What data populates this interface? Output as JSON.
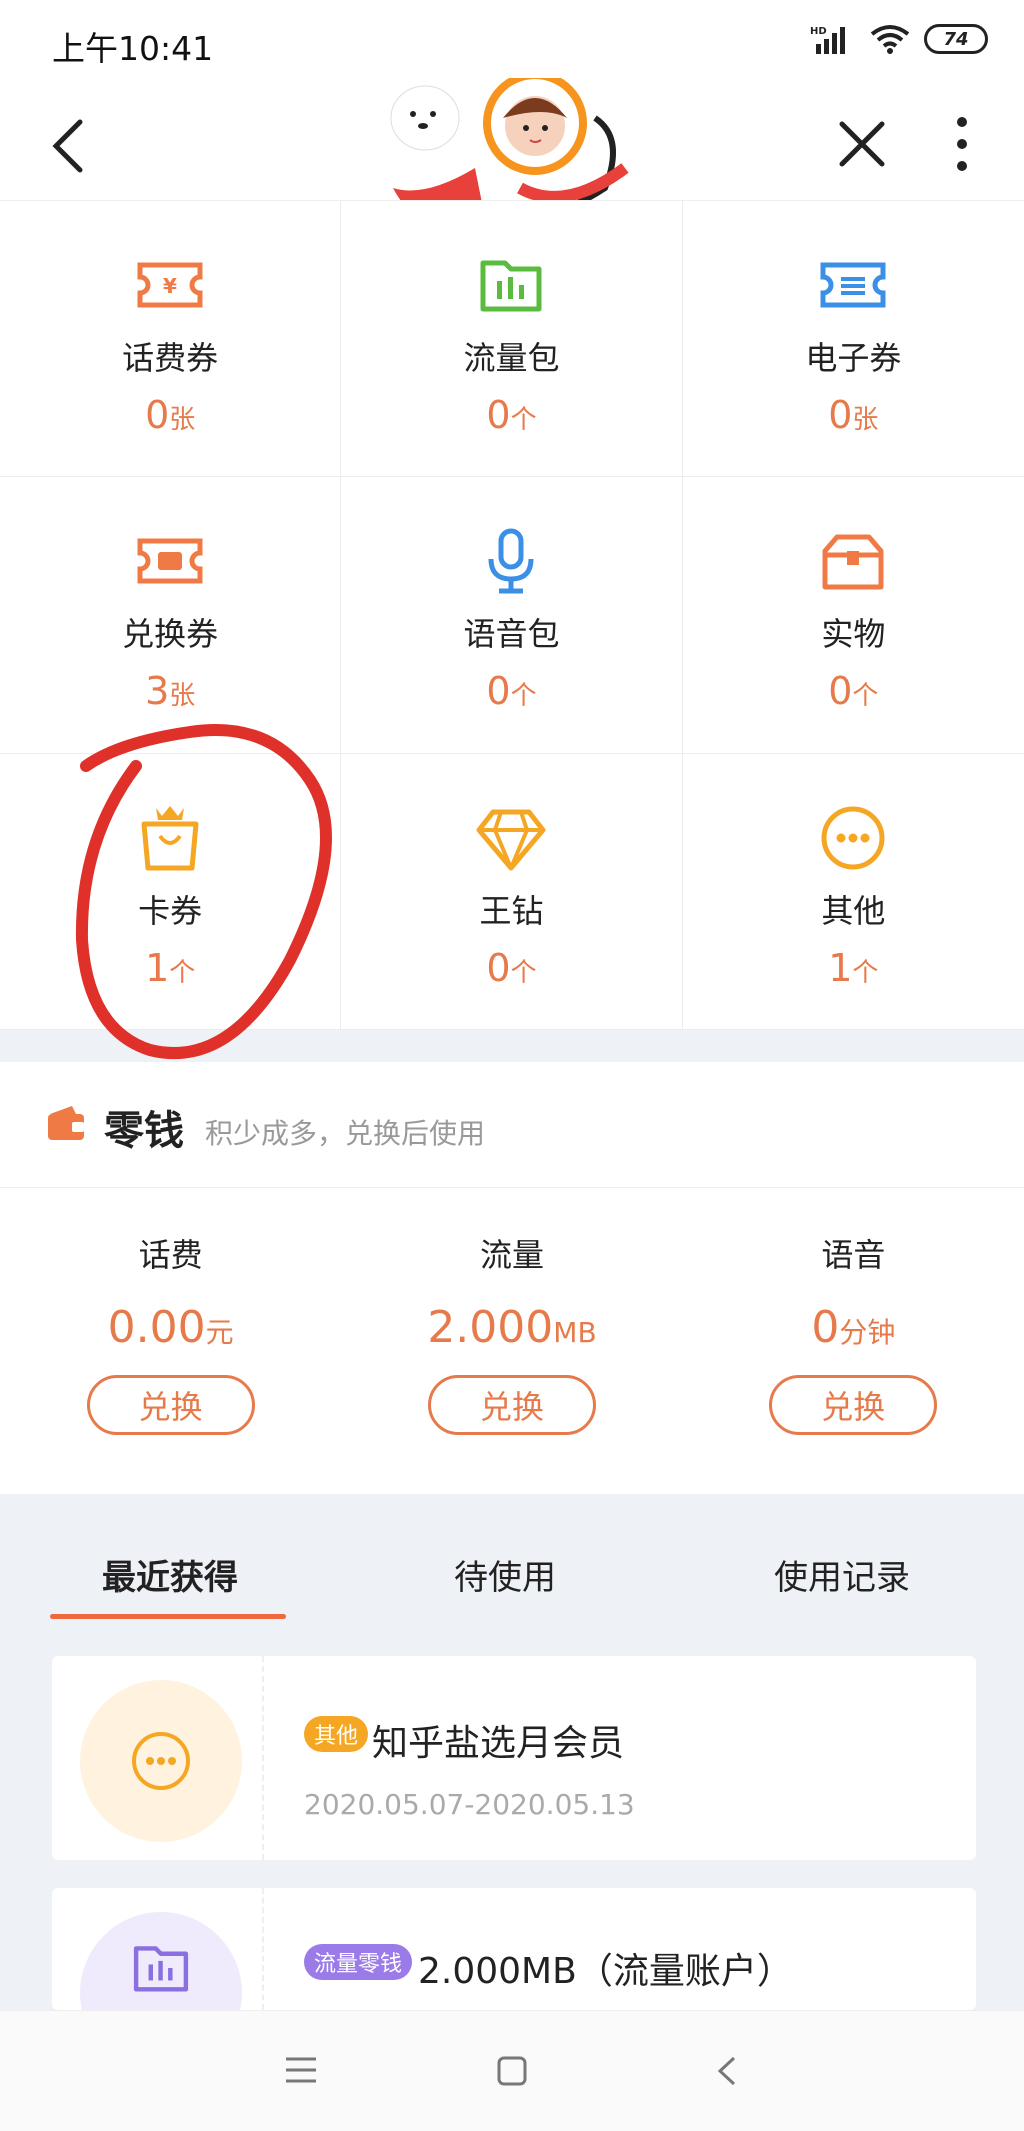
{
  "status": {
    "time": "上午10:41",
    "battery": "74"
  },
  "grid": [
    {
      "label": "话费券",
      "count": "0",
      "unit": "张",
      "icon": "ticket-yen-icon",
      "color": "#f07a45"
    },
    {
      "label": "流量包",
      "count": "0",
      "unit": "个",
      "icon": "folder-chart-icon",
      "color": "#5bbb3f"
    },
    {
      "label": "电子券",
      "count": "0",
      "unit": "张",
      "icon": "ticket-list-icon",
      "color": "#3c8fe6"
    },
    {
      "label": "兑换券",
      "count": "3",
      "unit": "张",
      "icon": "ticket-exchange-icon",
      "color": "#f07a45"
    },
    {
      "label": "语音包",
      "count": "0",
      "unit": "个",
      "icon": "microphone-icon",
      "color": "#3c8fe6"
    },
    {
      "label": "实物",
      "count": "0",
      "unit": "个",
      "icon": "gift-box-icon",
      "color": "#f07a45"
    },
    {
      "label": "卡券",
      "count": "1",
      "unit": "个",
      "icon": "crown-bag-icon",
      "color": "#f5a623"
    },
    {
      "label": "王钻",
      "count": "0",
      "unit": "个",
      "icon": "diamond-icon",
      "color": "#f5a623"
    },
    {
      "label": "其他",
      "count": "1",
      "unit": "个",
      "icon": "more-dots-icon",
      "color": "#f5a623"
    }
  ],
  "change": {
    "title": "零钱",
    "subtitle": "积少成多，兑换后使用",
    "items": [
      {
        "label": "话费",
        "value": "0.00",
        "unit": "元",
        "button": "兑换"
      },
      {
        "label": "流量",
        "value": "2.000",
        "unit": "MB",
        "button": "兑换"
      },
      {
        "label": "语音",
        "value": "0",
        "unit": "分钟",
        "button": "兑换"
      }
    ]
  },
  "tabs": [
    "最近获得",
    "待使用",
    "使用记录"
  ],
  "cards": [
    {
      "tag": "其他",
      "title": "知乎盐选月会员",
      "date": "2020.05.07-2020.05.13",
      "tag_color": "#f5a623",
      "circle_color": "#fff3e0"
    },
    {
      "tag": "流量零钱",
      "title": "2.000MB（流量账户）",
      "date": "",
      "tag_color": "#9a7be8",
      "circle_color": "#efeafc"
    }
  ]
}
